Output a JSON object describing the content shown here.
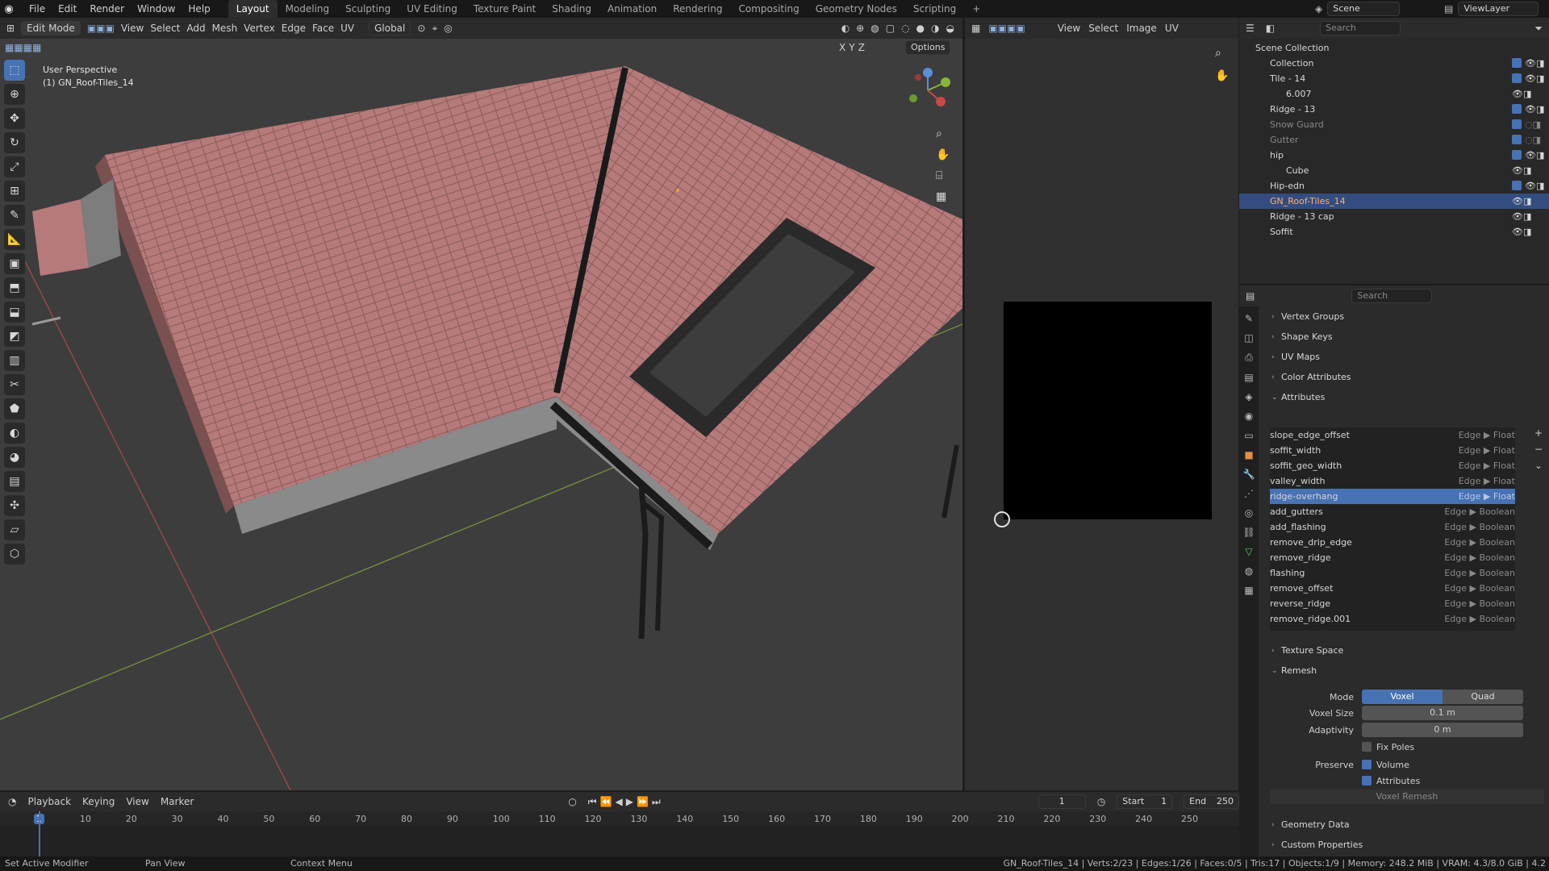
{
  "topbar": {
    "menus": [
      "File",
      "Edit",
      "Render",
      "Window",
      "Help"
    ],
    "workspaces": [
      "Layout",
      "Modeling",
      "Sculpting",
      "UV Editing",
      "Texture Paint",
      "Shading",
      "Animation",
      "Rendering",
      "Compositing",
      "Geometry Nodes",
      "Scripting"
    ],
    "active_workspace": "Layout",
    "scene_label": "Scene",
    "viewlayer_label": "ViewLayer"
  },
  "viewport": {
    "mode": "Edit Mode",
    "menus": [
      "View",
      "Select",
      "Add",
      "Mesh",
      "Vertex",
      "Edge",
      "Face",
      "UV"
    ],
    "transform_orientation": "Global",
    "options_label": "Options",
    "axis_labels": [
      "X",
      "Y",
      "Z"
    ],
    "perspective_label": "User Perspective",
    "object_label": "(1) GN_Roof-Tiles_14"
  },
  "image_editor": {
    "menus": [
      "View",
      "Select",
      "Image",
      "UV"
    ]
  },
  "outliner": {
    "search_placeholder": "Search",
    "rows": [
      {
        "name": "Scene Collection"
      },
      {
        "name": "Collection"
      },
      {
        "name": "Tile - 14"
      },
      {
        "name": "6.007"
      },
      {
        "name": "Ridge - 13"
      },
      {
        "name": "Snow Guard"
      },
      {
        "name": "Gutter"
      },
      {
        "name": "hip"
      },
      {
        "name": "Cube"
      },
      {
        "name": "Hip-edn"
      },
      {
        "name": "GN_Roof-Tiles_14"
      },
      {
        "name": "Ridge - 13 cap"
      },
      {
        "name": "Soffit"
      }
    ]
  },
  "properties": {
    "search_placeholder": "Search",
    "sections_top": [
      "Vertex Groups",
      "Shape Keys",
      "UV Maps",
      "Color Attributes",
      "Attributes"
    ],
    "attributes": [
      {
        "name": "slope_edge_offset",
        "meta": "Edge ▶ Float"
      },
      {
        "name": "soffit_width",
        "meta": "Edge ▶ Float"
      },
      {
        "name": "soffit_geo_width",
        "meta": "Edge ▶ Float"
      },
      {
        "name": "valley_width",
        "meta": "Edge ▶ Float"
      },
      {
        "name": "ridge-overhang",
        "meta": "Edge ▶ Float"
      },
      {
        "name": "add_gutters",
        "meta": "Edge ▶ Boolean"
      },
      {
        "name": "add_flashing",
        "meta": "Edge ▶ Boolean"
      },
      {
        "name": "remove_drip_edge",
        "meta": "Edge ▶ Boolean"
      },
      {
        "name": "remove_ridge",
        "meta": "Edge ▶ Boolean"
      },
      {
        "name": "flashing",
        "meta": "Edge ▶ Boolean"
      },
      {
        "name": "remove_offset",
        "meta": "Edge ▶ Boolean"
      },
      {
        "name": "reverse_ridge",
        "meta": "Edge ▶ Boolean"
      },
      {
        "name": "remove_ridge.001",
        "meta": "Edge ▶ Boolean"
      }
    ],
    "texture_space": "Texture Space",
    "remesh": "Remesh",
    "mode_label": "Mode",
    "mode_voxel": "Voxel",
    "mode_quad": "Quad",
    "voxel_size_label": "Voxel Size",
    "voxel_size_value": "0.1 m",
    "adaptivity_label": "Adaptivity",
    "adaptivity_value": "0 m",
    "fix_poles": "Fix Poles",
    "preserve_label": "Preserve",
    "preserve_volume": "Volume",
    "preserve_attributes": "Attributes",
    "voxel_remesh_button": "Voxel Remesh",
    "geometry_data": "Geometry Data",
    "custom_properties": "Custom Properties"
  },
  "timeline": {
    "menus": [
      "Playback",
      "Keying",
      "View",
      "Marker"
    ],
    "current_frame": "1",
    "start_label": "Start",
    "start_value": "1",
    "end_label": "End",
    "end_value": "250",
    "ticks": [
      "1",
      "10",
      "20",
      "30",
      "40",
      "50",
      "60",
      "70",
      "80",
      "90",
      "100",
      "110",
      "120",
      "130",
      "140",
      "150",
      "160",
      "170",
      "180",
      "190",
      "200",
      "210",
      "220",
      "230",
      "240",
      "250"
    ]
  },
  "statusbar": {
    "left_1": "Set Active Modifier",
    "left_2": "Pan View",
    "left_3": "Context Menu",
    "right": "GN_Roof-Tiles_14 | Verts:2/23 | Edges:1/26 | Faces:0/5 | Tris:17 | Objects:1/9 | Memory: 248.2 MiB | VRAM: 4.3/8.0 GiB | 4.2"
  },
  "colors": {
    "accent": "#4772b3",
    "roof_tile": "#b67a7a",
    "selected_row": "#334d80"
  }
}
